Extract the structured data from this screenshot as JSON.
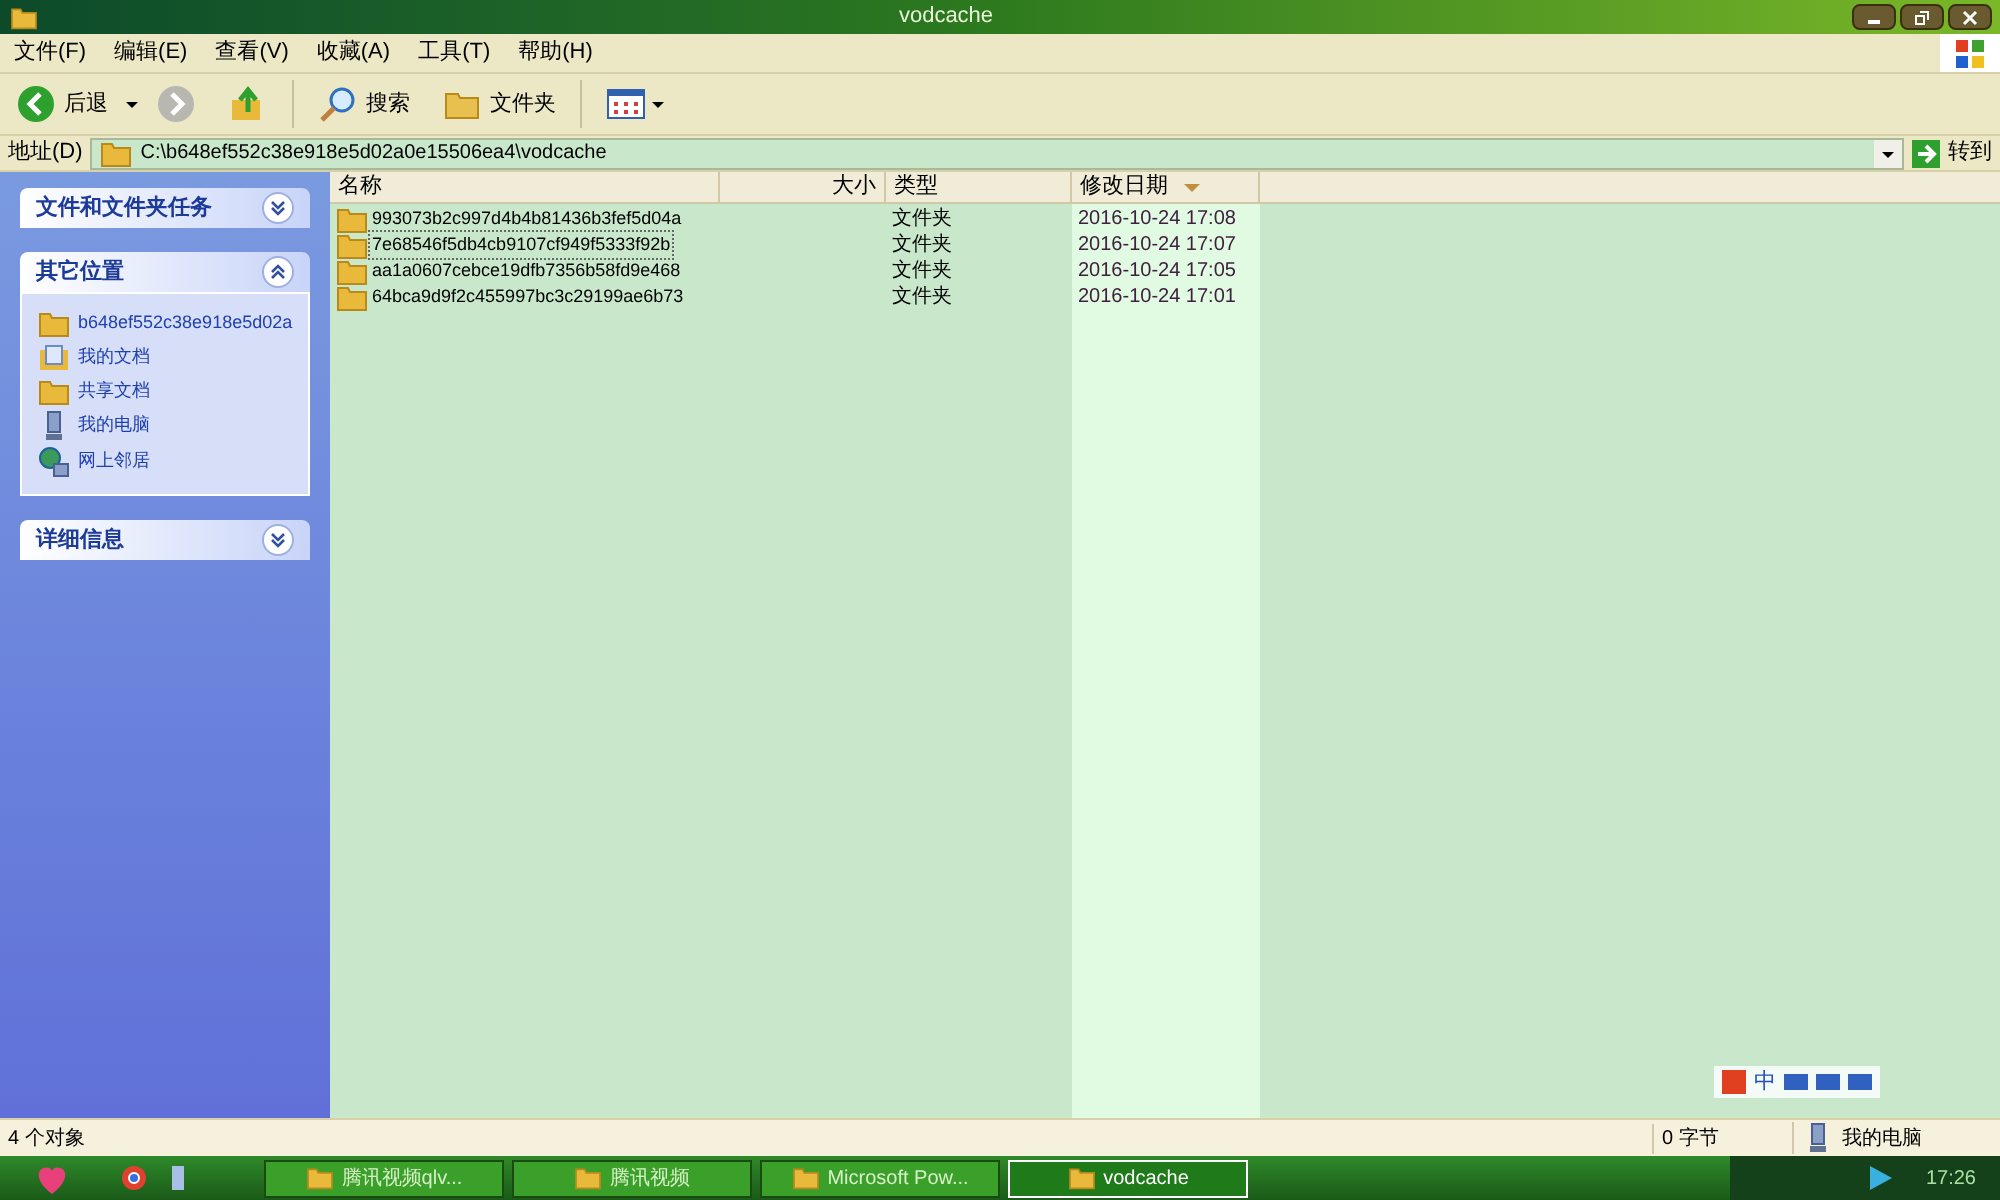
{
  "window": {
    "title": "vodcache"
  },
  "menu": [
    "文件(F)",
    "编辑(E)",
    "查看(V)",
    "收藏(A)",
    "工具(T)",
    "帮助(H)"
  ],
  "toolbar": {
    "back": "后退",
    "search": "搜索",
    "folders": "文件夹"
  },
  "address": {
    "label": "地址(D)",
    "value": "C:\\b648ef552c38e918e5d02a0e15506ea4\\vodcache",
    "go": "转到"
  },
  "sidebar": [
    {
      "title": "文件和文件夹任务",
      "expanded": false
    },
    {
      "title": "其它位置",
      "expanded": true,
      "items": [
        {
          "label": "b648ef552c38e918e5d02a",
          "kind": "folder"
        },
        {
          "label": "我的文档",
          "kind": "documents"
        },
        {
          "label": "共享文档",
          "kind": "folder"
        },
        {
          "label": "我的电脑",
          "kind": "computer"
        },
        {
          "label": "网上邻居",
          "kind": "network"
        }
      ]
    },
    {
      "title": "详细信息",
      "expanded": false
    }
  ],
  "table": {
    "columns": [
      {
        "label": "名称",
        "sorted": false
      },
      {
        "label": "大小",
        "sorted": false
      },
      {
        "label": "类型",
        "sorted": false
      },
      {
        "label": "修改日期",
        "sorted": true
      }
    ],
    "rows": [
      {
        "name": "993073b2c997d4b4b81436b3fef5d04a",
        "type": "文件夹",
        "modified": "2016-10-24 17:08",
        "focused": false
      },
      {
        "name": "7e68546f5db4cb9107cf949f5333f92b",
        "type": "文件夹",
        "modified": "2016-10-24 17:07",
        "focused": true
      },
      {
        "name": "aa1a0607cebce19dfb7356b58fd9e468",
        "type": "文件夹",
        "modified": "2016-10-24 17:05",
        "focused": false
      },
      {
        "name": "64bca9d9f2c455997bc3c29199ae6b73",
        "type": "文件夹",
        "modified": "2016-10-24 17:01",
        "focused": false
      }
    ]
  },
  "ime": {
    "mode": "中"
  },
  "status_bar": {
    "objects": "4 个对象",
    "size": "0 字节",
    "location": "我的电脑"
  },
  "taskbar": {
    "tasks": [
      {
        "label": "腾讯视频qlv...",
        "selected": false
      },
      {
        "label": "腾讯视频",
        "selected": false
      },
      {
        "label": "Microsoft Pow...",
        "selected": false
      },
      {
        "label": "vodcache",
        "selected": true
      }
    ],
    "clock": "17:26"
  }
}
